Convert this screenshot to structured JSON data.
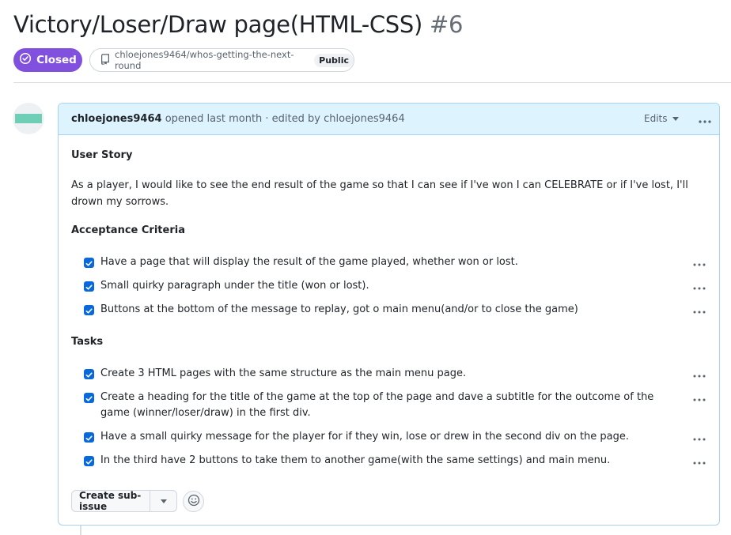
{
  "issue": {
    "title": "Victory/Loser/Draw page(HTML-CSS)",
    "number": "#6",
    "state": "Closed",
    "state_color": "#8250df",
    "repo": "chloejones9464/whos-getting-the-next-round",
    "visibility": "Public"
  },
  "comment": {
    "author": "chloejones9464",
    "meta": "opened last month · edited by chloejones9464",
    "edits_label": "Edits",
    "user_story_heading": "User Story",
    "user_story": "As a player, I would like to see the end result of the game so that I can see if I've won I can CELEBRATE or if I've lost, I'll drown my sorrows.",
    "criteria_heading": "Acceptance Criteria",
    "criteria": [
      "Have a page that will display the result of the game played, whether won or lost.",
      "Small quirky paragraph under the title (won or lost).",
      "Buttons at the bottom of the message to replay, got o main menu(and/or to close the game)"
    ],
    "tasks_heading": "Tasks",
    "tasks": [
      "Create 3 HTML pages with the same structure as the main menu page.",
      "Create a heading for the title of the game at the top of the page and dave a subtitle for the outcome of the game (winner/loser/draw) in the first div.",
      "Have a small quirky message for the player for if they win, lose or drew in the second div on the page.",
      "In the third have 2 buttons to take them to another game(with the same settings) and main menu."
    ],
    "create_sub_issue_label": "Create sub-issue"
  },
  "colors": {
    "checkbox": "#0969da",
    "header_bg": "#ddf4ff",
    "header_border": "#a8d3f0",
    "avatar": "#6fcfb6"
  },
  "icons": [
    "check-circle-icon",
    "repo-icon",
    "triangle-down-icon",
    "kebab-horizontal-icon",
    "checkmark-icon",
    "smiley-icon"
  ]
}
